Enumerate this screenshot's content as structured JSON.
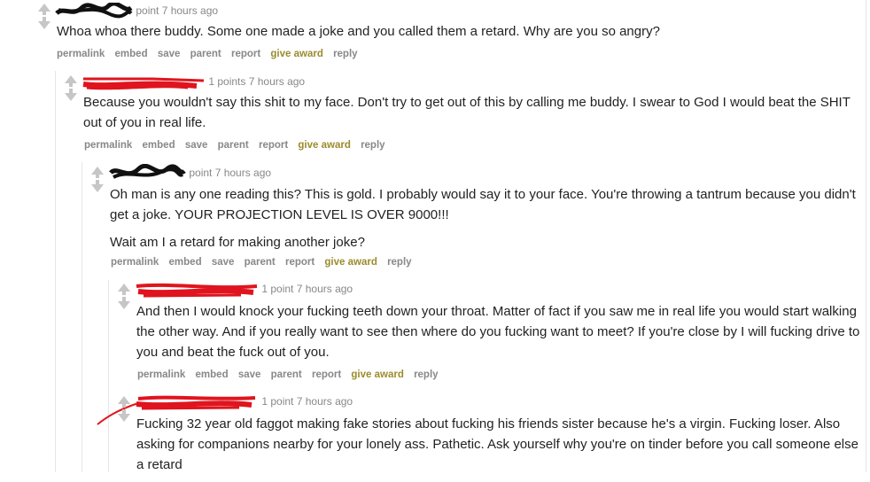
{
  "comments": [
    {
      "points_text": "point 7 hours ago",
      "body": [
        "Whoa whoa there buddy. Some one made a joke and you called them a retard. Why are you so angry?"
      ]
    },
    {
      "points_text": "1 points 7 hours ago",
      "body": [
        "Because you wouldn't say this shit to my face. Don't try to get out of this by calling me buddy. I swear to God I would beat the SHIT out of you in real life."
      ]
    },
    {
      "points_text": "point 7 hours ago",
      "body": [
        "Oh man is any one reading this? This is gold. I probably would say it to your face. You're throwing a tantrum because you didn't get a joke. YOUR PROJECTION LEVEL IS OVER 9000!!!",
        "Wait am I a retard for making another joke?"
      ]
    },
    {
      "points_text": "1 point 7 hours ago",
      "body": [
        "And then I would knock your fucking teeth down your throat. Matter of fact if you saw me in real life you would start walking the other way. And if you really want to see then where do you fucking want to meet? If you're close by I will fucking drive to you and beat the fuck out of you."
      ]
    },
    {
      "points_text": "1 point 7 hours ago",
      "body": [
        "Fucking 32 year old faggot making fake stories about fucking his friends sister because he's a virgin. Fucking loser. Also asking for companions nearby for your lonely ass. Pathetic. Ask yourself why you're on tinder before you call someone else a retard"
      ]
    }
  ],
  "buttons": {
    "permalink": "permalink",
    "embed": "embed",
    "save": "save",
    "parent": "parent",
    "report": "report",
    "give_award": "give award",
    "reply": "reply"
  },
  "colors": {
    "award": "#9a8c2c",
    "scribble_black": "#111111",
    "scribble_red": "#e0141e",
    "arrow": "#c6c6c6"
  },
  "icons": {
    "upvote": "upvote-arrow-icon",
    "downvote": "downvote-arrow-icon"
  }
}
